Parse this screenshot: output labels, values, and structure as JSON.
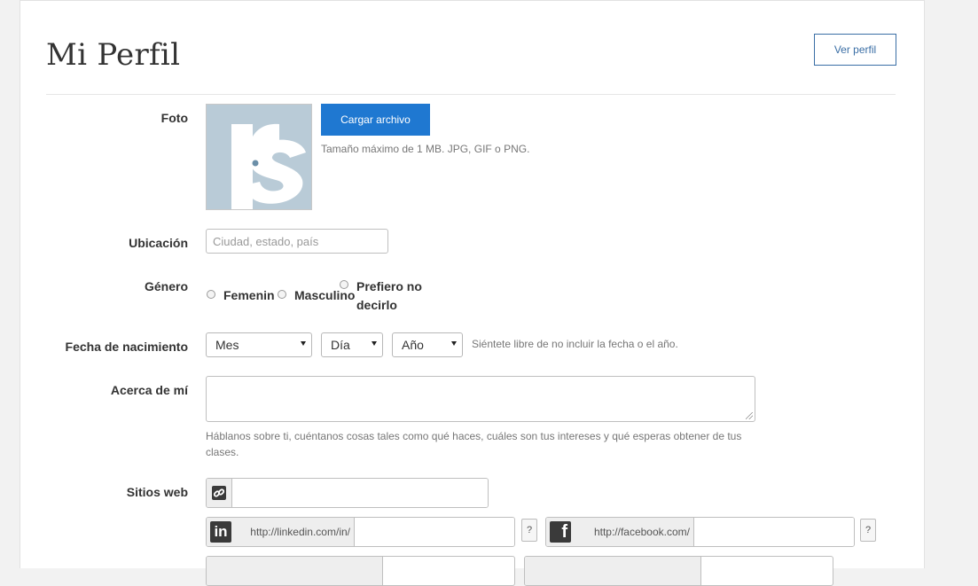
{
  "header": {
    "title": "Mi Perfil",
    "view_profile_label": "Ver perfil"
  },
  "photo": {
    "label": "Foto",
    "upload_label": "Cargar archivo",
    "hint": "Tamaño máximo de 1 MB. JPG, GIF o PNG.",
    "avatar_text": "rs"
  },
  "location": {
    "label": "Ubicación",
    "placeholder": "Ciudad, estado, país",
    "value": ""
  },
  "gender": {
    "label": "Género",
    "options": [
      "Femenino",
      "Masculino",
      "Prefiero no decirlo"
    ],
    "option_lines": {
      "female": "Femenin",
      "male": "Masculino",
      "other_line1": "Prefiero no",
      "other_line2": "decirlo"
    },
    "selected": null
  },
  "birthdate": {
    "label": "Fecha de nacimiento",
    "month": "Mes",
    "day": "Día",
    "year": "Año",
    "hint": "Siéntete libre de no incluir la fecha o el año."
  },
  "about": {
    "label": "Acerca de mí",
    "value": "",
    "hint": "Háblanos sobre ti, cuéntanos cosas tales como qué haces, cuáles son tus intereses y qué esperas obtener de tus clases."
  },
  "websites": {
    "label": "Sitios web",
    "website_value": "",
    "linkedin_prefix": "http://linkedin.com/in/",
    "facebook_prefix": "http://facebook.com/",
    "help_label": "?",
    "linkedin_icon": "in",
    "facebook_icon": "f"
  },
  "icons": {
    "link": "link-icon",
    "linkedin": "linkedin-icon",
    "facebook": "facebook-icon"
  },
  "colors": {
    "primary": "#1f78d1",
    "outline": "#3a6ea5",
    "avatar_bg": "#b9cbd7"
  }
}
